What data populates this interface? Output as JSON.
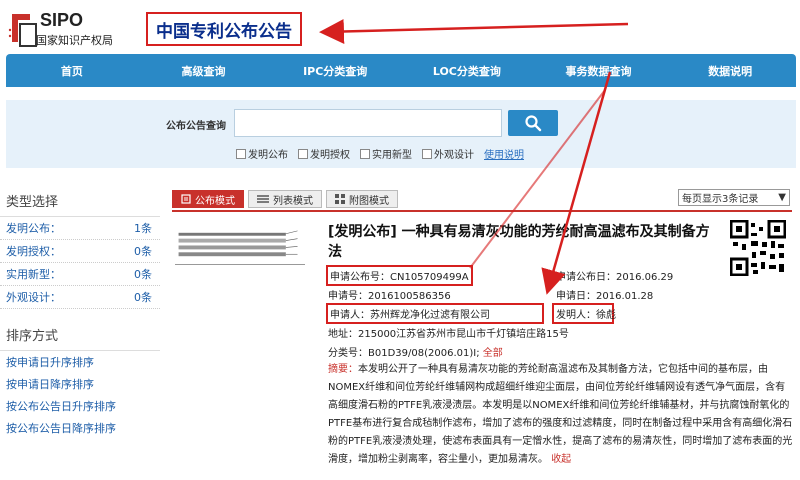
{
  "header": {
    "logo_text": "SIPO",
    "logo_cn": "国家知识产权局",
    "site_title": "中国专利公布公告"
  },
  "nav": {
    "items": [
      "首页",
      "高级查询",
      "IPC分类查询",
      "LOC分类查询",
      "事务数据查询",
      "数据说明"
    ]
  },
  "search": {
    "label": "公布公告查询",
    "value": "",
    "options": [
      "发明公布",
      "发明授权",
      "实用新型",
      "外观设计"
    ],
    "help_link": "使用说明"
  },
  "sidebar": {
    "type_heading": "类型选择",
    "types": [
      {
        "label": "发明公布：",
        "count": "1条"
      },
      {
        "label": "发明授权：",
        "count": "0条"
      },
      {
        "label": "实用新型：",
        "count": "0条"
      },
      {
        "label": "外观设计：",
        "count": "0条"
      }
    ],
    "sort_heading": "排序方式",
    "sorts": [
      "按申请日升序排序",
      "按申请日降序排序",
      "按公布公告日升序排序",
      "按公布公告日降序排序"
    ]
  },
  "toolbar": {
    "tabs": [
      "公布模式",
      "列表模式",
      "附图模式"
    ],
    "per_page": "每页显示3条记录"
  },
  "patent": {
    "title": "[发明公布] 一种具有易清灰功能的芳纶耐高温滤布及其制备方法",
    "pub_no": "申请公布号：CN105709499A",
    "pub_date": "申请公布日：2016.06.29",
    "app_no": "申请号：2016100586356",
    "app_date": "申请日：2016.01.28",
    "applicant": "申请人：苏州辉龙净化过滤有限公司",
    "inventor": "发明人：徐彪",
    "address": "地址：215000江苏省苏州市昆山市千灯镇培庄路15号",
    "ipc_label": "分类号：B01D39/08(2006.01)I;",
    "ipc_all": "全部",
    "abstract_label": "摘要：",
    "abstract": "本发明公开了一种具有易清灰功能的芳纶耐高温滤布及其制备方法，它包括中间的基布层，由NOMEX纤维和间位芳纶纤维辅网构成超细纤维迎尘面层，由间位芳纶纤维辅网设有透气净气面层，含有高细度滑石粉的PTFE乳液浸渍层。本发明是以NOMEX纤维和间位芳纶纤维辅基材，并与抗腐蚀耐氧化的PTFE基布进行复合成毡制作滤布，增加了滤布的强度和过滤精度，同时在制备过程中采用含有高细化滑石粉的PTFE乳液浸渍处理，使滤布表面具有一定憎水性，提高了滤布的易清灰性，同时增加了滤布表面的光滑度，增加粉尘剥离率，容尘量小，更加易清灰。",
    "collapse": "收起"
  },
  "colors": {
    "nav_blue": "#2a89c6",
    "accent_red": "#d6201f",
    "title_blue": "#0a2e8c"
  }
}
